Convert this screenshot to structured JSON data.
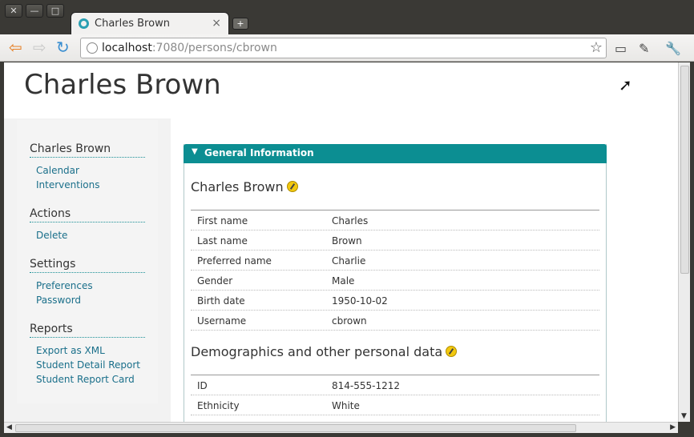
{
  "window": {
    "close_glyph": "✕",
    "minimize_glyph": "—",
    "maximize_glyph": "□"
  },
  "tab": {
    "title": "Charles Brown",
    "close_glyph": "×",
    "new_tab_glyph": "+"
  },
  "toolbar": {
    "back_glyph": "⇦",
    "forward_glyph": "⇨",
    "reload_glyph": "↻",
    "url_host": "localhost",
    "url_rest": ":7080/persons/cbrown",
    "star_glyph": "☆",
    "fullscreen_glyph": "▭",
    "pin_glyph": "✎",
    "wrench_glyph": "🔧"
  },
  "page": {
    "title": "Charles Brown"
  },
  "sidebar": {
    "sections": [
      {
        "heading": "Charles Brown",
        "links": [
          "Calendar",
          "Interventions"
        ]
      },
      {
        "heading": "Actions",
        "links": [
          "Delete"
        ]
      },
      {
        "heading": "Settings",
        "links": [
          "Preferences",
          "Password"
        ]
      },
      {
        "heading": "Reports",
        "links": [
          "Export as XML",
          "Student Detail Report",
          "Student Report Card"
        ]
      }
    ]
  },
  "panel": {
    "header": "General Information",
    "caret_glyph": "▼",
    "general": {
      "title": "Charles Brown",
      "rows": [
        {
          "label": "First name",
          "value": "Charles"
        },
        {
          "label": "Last name",
          "value": "Brown"
        },
        {
          "label": "Preferred name",
          "value": "Charlie"
        },
        {
          "label": "Gender",
          "value": "Male"
        },
        {
          "label": "Birth date",
          "value": "1950-10-02"
        },
        {
          "label": "Username",
          "value": "cbrown"
        }
      ]
    },
    "demographics": {
      "title": "Demographics and other personal data",
      "rows": [
        {
          "label": "ID",
          "value": "814-555-1212"
        },
        {
          "label": "Ethnicity",
          "value": "White"
        }
      ]
    }
  },
  "scrollbars": {
    "up_glyph": "▲",
    "down_glyph": "▼",
    "left_glyph": "◀",
    "right_glyph": "▶"
  },
  "colors": {
    "accent": "#0c8e92",
    "link": "#1a6f8a"
  }
}
